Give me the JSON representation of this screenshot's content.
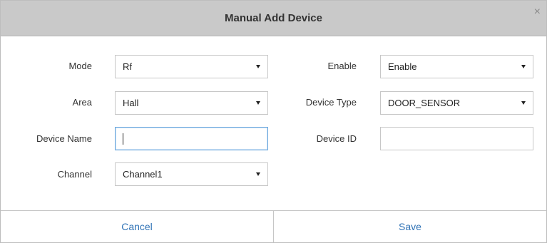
{
  "dialog": {
    "title": "Manual Add Device",
    "close_icon": "×"
  },
  "form": {
    "mode": {
      "label": "Mode",
      "value": "Rf"
    },
    "enable": {
      "label": "Enable",
      "value": "Enable"
    },
    "area": {
      "label": "Area",
      "value": "Hall"
    },
    "device_type": {
      "label": "Device Type",
      "value": "DOOR_SENSOR"
    },
    "device_name": {
      "label": "Device Name",
      "value": ""
    },
    "device_id": {
      "label": "Device ID",
      "value": ""
    },
    "channel": {
      "label": "Channel",
      "value": "Channel1"
    }
  },
  "footer": {
    "cancel_label": "Cancel",
    "save_label": "Save"
  },
  "colors": {
    "titlebar": "#c9c9c9",
    "button_text": "#2f72b6",
    "focus_border": "#6aa7dd"
  },
  "icons": {
    "close": "close-icon",
    "dropdown": "chevron-down-icon"
  }
}
